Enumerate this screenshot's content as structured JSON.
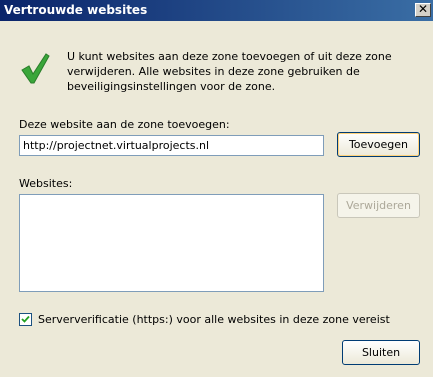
{
  "window": {
    "title": "Vertrouwde websites",
    "close_glyph": "✕"
  },
  "intro": {
    "icon": "green-check-icon",
    "text": "U kunt websites aan deze zone toevoegen of uit deze zone verwijderen. Alle websites in deze zone gebruiken de beveiligingsinstellingen voor de zone."
  },
  "add": {
    "label": "Deze website aan de zone toevoegen:",
    "value": "http://projectnet.virtualprojects.nl",
    "button": "Toevoegen"
  },
  "sites": {
    "label": "Websites:",
    "items": [],
    "remove_button": "Verwijderen"
  },
  "verify": {
    "checked": true,
    "label": "Serververificatie (https:) voor alle websites in deze zone vereist"
  },
  "footer": {
    "close_button": "Sluiten"
  },
  "colors": {
    "titlebar_start": "#0a246a",
    "titlebar_end": "#3a6ea5",
    "dialog_bg": "#ece9d8",
    "check_green": "#3aa63a"
  }
}
